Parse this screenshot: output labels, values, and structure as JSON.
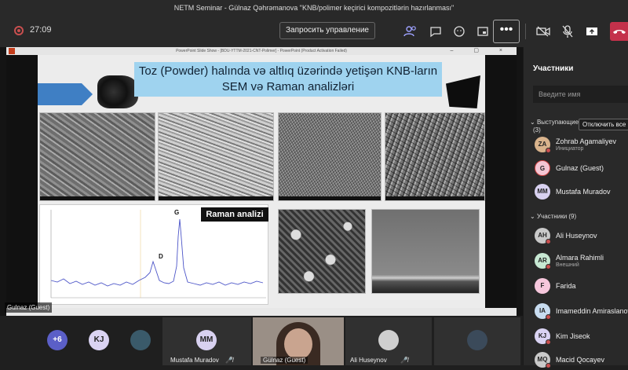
{
  "window_title": "NETM Seminar - Gülnaz Qəhrəmanova \"KNB/polimer keçirici kompozitlərin hazırlanması\"",
  "toolbar": {
    "timer": "27:09",
    "request_control_label": "Запросить управление",
    "more_label": "•••"
  },
  "slide_window": {
    "title": "PowerPoint Slide Show - [BDU-YTTM-2021-CNT-Polimer] - PowerPoint (Product Activation Failed)"
  },
  "slide": {
    "title_line1": "Toz (Powder) halında və altlıq üzərində yetişən KNB-ların",
    "title_line2": "SEM və Raman analizləri",
    "raman_label": "Raman analizi",
    "peak_g": "G",
    "peak_d": "D"
  },
  "presenter_name_tag": "Gulnaz (Guest)",
  "sidebar": {
    "title": "Участники",
    "search_placeholder": "Введите имя",
    "presenters_heading": "Выступающие",
    "presenters_count": "(3)",
    "mute_all_label": "Отключить все",
    "attendees_heading": "Участники (9)",
    "presenters": [
      {
        "name": "Zohrab Agamaliyev",
        "sub": "Инициатор",
        "initials": "ZA",
        "color": "#d9b38c"
      },
      {
        "name": "Gulnaz (Guest)",
        "sub": "",
        "initials": "G",
        "color": "#f4c6d4"
      },
      {
        "name": "Mustafa Muradov",
        "sub": "",
        "initials": "MM",
        "color": "#d8d1f0"
      }
    ],
    "attendees": [
      {
        "name": "Ali Huseynov",
        "sub": "",
        "initials": "AH",
        "color": "#c9c9c9"
      },
      {
        "name": "Almara Rahimli",
        "sub": "Внешний",
        "initials": "AR",
        "color": "#c7e8d3"
      },
      {
        "name": "Farida",
        "sub": "",
        "initials": "F",
        "color": "#f6c7dc"
      },
      {
        "name": "Imameddin Amiraslanov",
        "sub": "",
        "initials": "IA",
        "color": "#c8dcf0"
      },
      {
        "name": "Kim Jiseok",
        "sub": "",
        "initials": "KJ",
        "color": "#dad3f3"
      },
      {
        "name": "Macid Qocayev",
        "sub": "",
        "initials": "MQ",
        "color": "#c9c9c9"
      }
    ]
  },
  "bottom_strip": {
    "overflow_count": "+6",
    "kj_initials": "KJ",
    "mm_initials": "MM",
    "tiles": [
      {
        "label": "Mustafa Muradov"
      },
      {
        "label": "Gülnaz (Guest)"
      },
      {
        "label": "Ali Huseynov"
      }
    ]
  }
}
